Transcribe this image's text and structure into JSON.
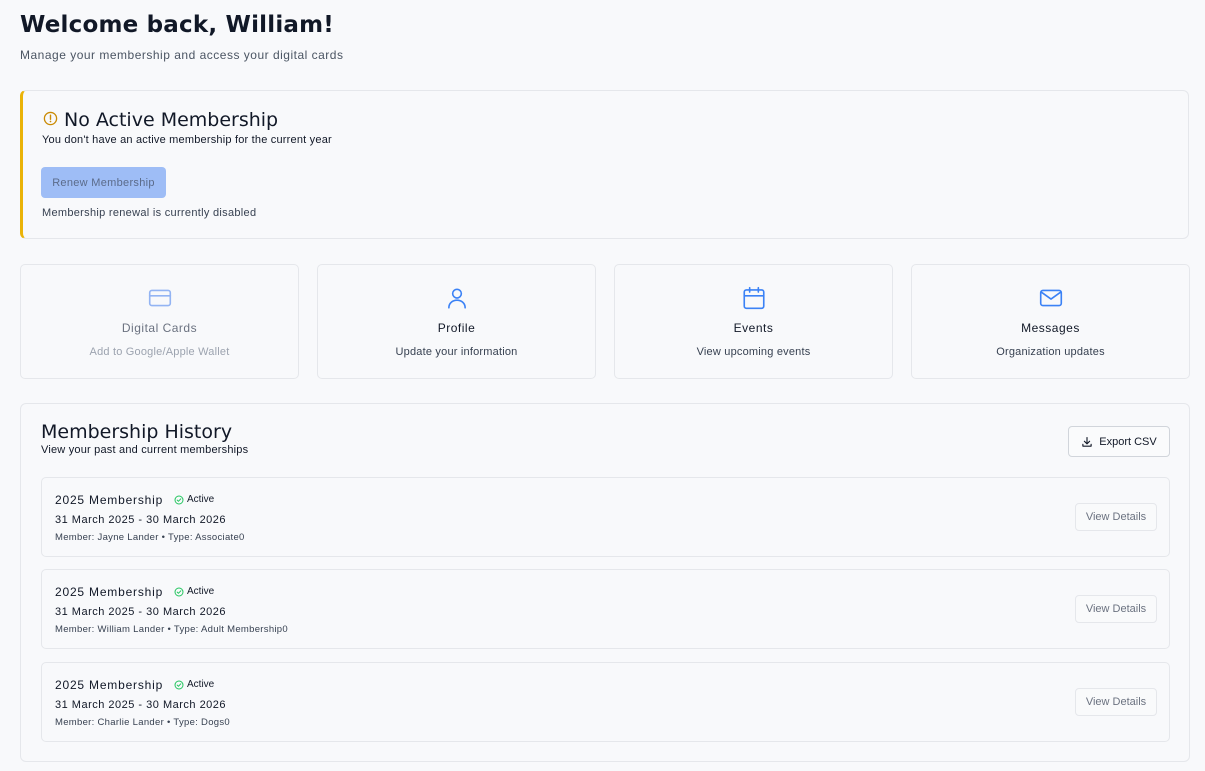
{
  "header": {
    "welcome": "Welcome back, William!",
    "subtitle": "Manage your membership and access your digital cards"
  },
  "alert": {
    "icon": "alert-circle-icon",
    "title": "No Active Membership",
    "description": "You don't have an active membership for the current year",
    "renew_label": "Renew Membership",
    "renew_note": "Membership renewal is currently disabled",
    "accent": "#eab308"
  },
  "cards": [
    {
      "icon": "credit-card-icon",
      "title": "Digital Cards",
      "subtitle": "Add to Google/Apple Wallet",
      "disabled": true
    },
    {
      "icon": "user-icon",
      "title": "Profile",
      "subtitle": "Update your information",
      "disabled": false
    },
    {
      "icon": "calendar-icon",
      "title": "Events",
      "subtitle": "View upcoming events",
      "disabled": false
    },
    {
      "icon": "mail-icon",
      "title": "Messages",
      "subtitle": "Organization updates",
      "disabled": false
    }
  ],
  "history": {
    "title": "Membership History",
    "subtitle": "View your past and current memberships",
    "export_label": "Export CSV",
    "rows": [
      {
        "title": "2025 Membership",
        "status": "Active",
        "dates": "31 March 2025 - 30 March 2026",
        "meta": "Member: Jayne Lander • Type: Associate0",
        "action": "View Details"
      },
      {
        "title": "2025 Membership",
        "status": "Active",
        "dates": "31 March 2025 - 30 March 2026",
        "meta": "Member: William Lander • Type: Adult Membership0",
        "action": "View Details"
      },
      {
        "title": "2025 Membership",
        "status": "Active",
        "dates": "31 March 2025 - 30 March 2026",
        "meta": "Member: Charlie Lander • Type: Dogs0",
        "action": "View Details"
      }
    ]
  },
  "colors": {
    "primary": "#3b82f6",
    "primary_disabled": "#9ebdf6",
    "success": "#22c55e",
    "warning": "#eab308"
  }
}
